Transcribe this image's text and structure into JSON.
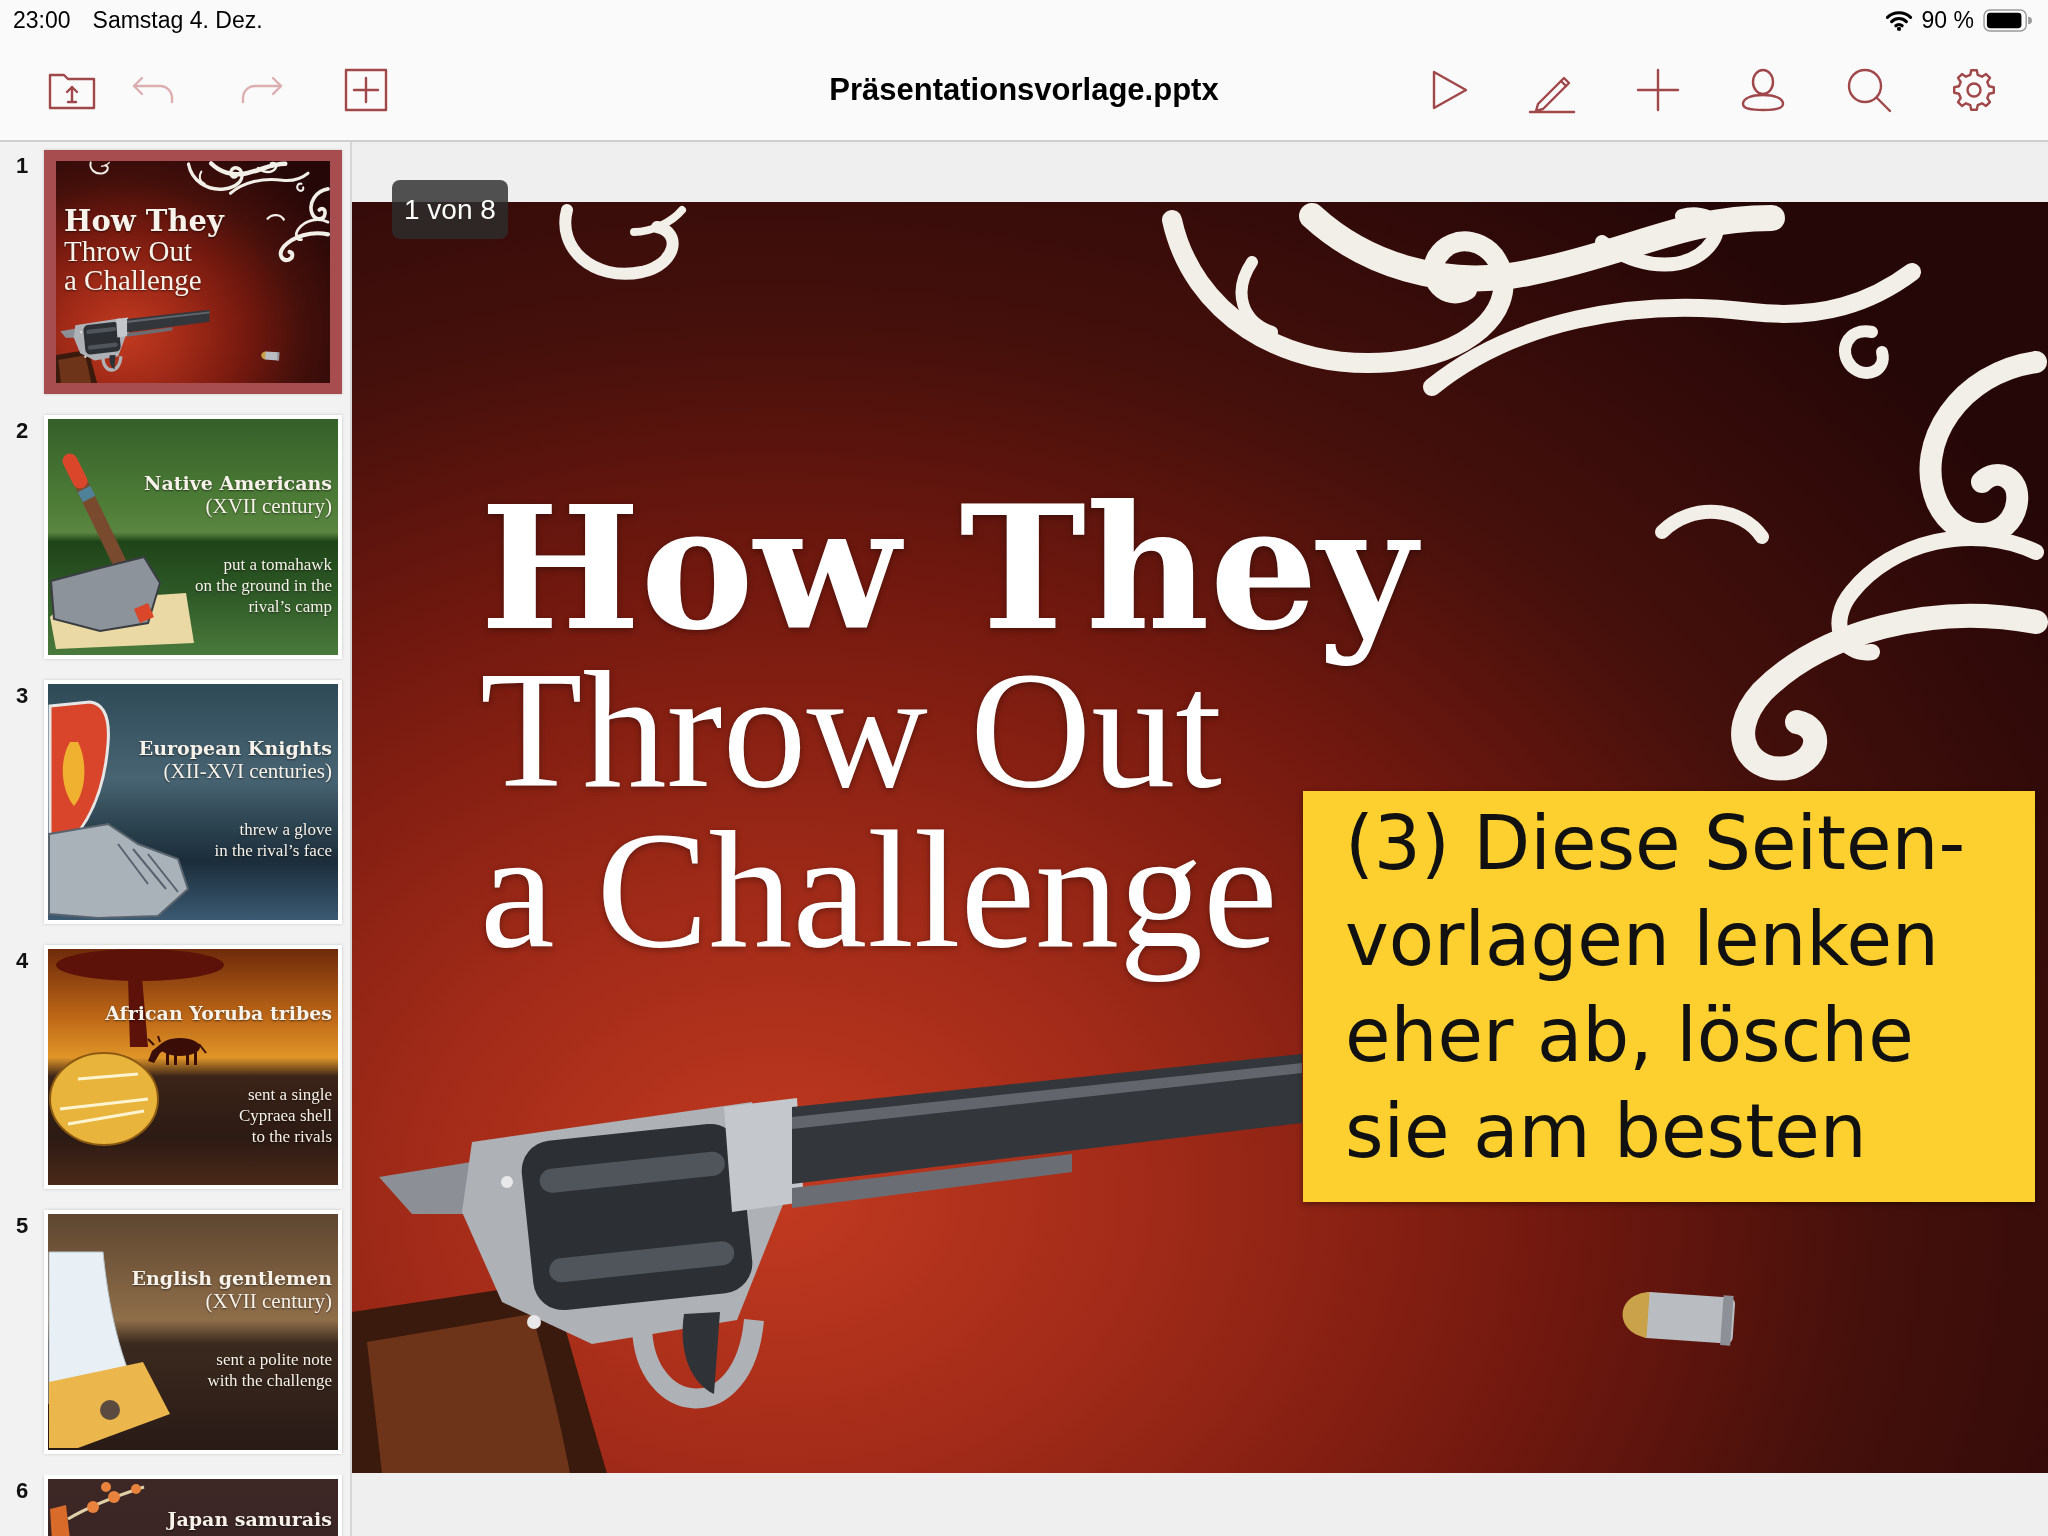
{
  "status_bar": {
    "time": "23:00",
    "date": "Samstag 4. Dez.",
    "battery": "90 %"
  },
  "toolbar": {
    "left_buttons": [
      {
        "kind": "folder",
        "disabled": false
      },
      {
        "kind": "undo",
        "disabled": true
      },
      {
        "kind": "redo",
        "disabled": true
      },
      {
        "kind": "add_slide",
        "disabled": false
      }
    ],
    "title": "Präsentationsvorlage.pptx",
    "right_buttons": [
      {
        "kind": "play"
      },
      {
        "kind": "pencil"
      },
      {
        "kind": "plus"
      },
      {
        "kind": "person"
      },
      {
        "kind": "search"
      },
      {
        "kind": "gear"
      }
    ]
  },
  "slides": [
    {
      "number": "1",
      "selected": true,
      "kind": "revolver",
      "title": "How They",
      "subtitle": [
        "Throw Out",
        "a Challenge"
      ]
    },
    {
      "number": "2",
      "selected": false,
      "kind": "tomahawk",
      "title": "Native Americans",
      "subtitle": [
        "(XVII century)"
      ],
      "body": [
        "put a tomahawk",
        "on the ground in the",
        "rival’s camp"
      ]
    },
    {
      "number": "3",
      "selected": false,
      "kind": "glove",
      "title": "European Knights",
      "subtitle": [
        "(XII-XVI centuries)"
      ],
      "body": [
        "threw a glove",
        "in the rival’s face"
      ]
    },
    {
      "number": "4",
      "selected": false,
      "kind": "shell",
      "title": "African Yoruba tribes",
      "body": [
        "sent a single",
        "Cypraea shell",
        "to the rivals"
      ]
    },
    {
      "number": "5",
      "selected": false,
      "kind": "letter",
      "title": "English gentlemen",
      "subtitle": [
        "(XVII century)"
      ],
      "body": [
        "sent a polite note",
        "with the challenge"
      ]
    },
    {
      "number": "6",
      "selected": false,
      "kind": "blossom",
      "title": "Japan samurais"
    }
  ],
  "canvas": {
    "counter": "1 von 8",
    "title": "How They",
    "subtitle": [
      "Throw Out",
      "a Challenge"
    ],
    "note": [
      "(3) Diese Seiten-",
      "vorlagen lenken",
      "eher ab, lösche",
      "sie am besten"
    ]
  }
}
